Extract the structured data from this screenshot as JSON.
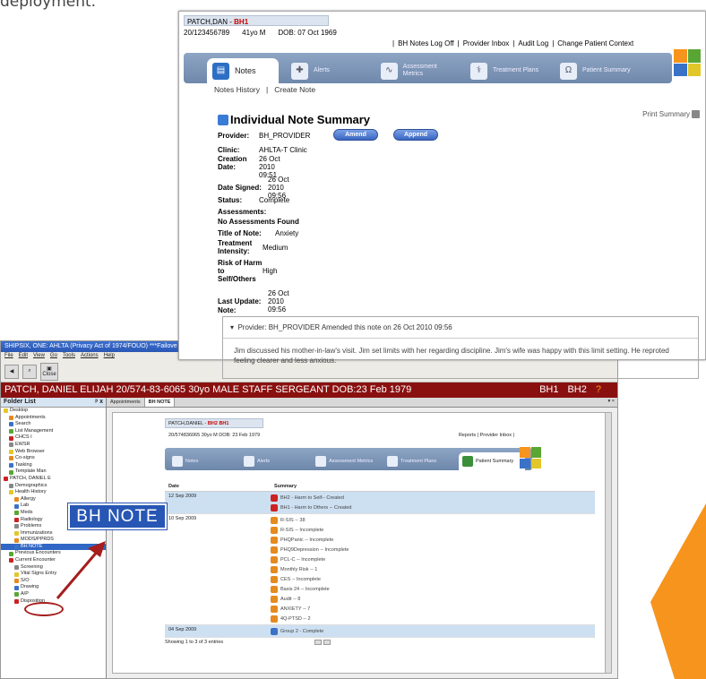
{
  "caption": "deployment.",
  "front": {
    "patient": "PATCH,DAN",
    "patient_bh": "BH1",
    "id": "20/123456789",
    "age": "41yo M",
    "dob": "DOB: 07 Oct 1969",
    "links": [
      "BH Notes Log Off",
      "Provider Inbox",
      "Audit Log",
      "Change Patient Context"
    ],
    "tabs": [
      {
        "label": "Notes",
        "icon": "notes-icon"
      },
      {
        "label": "Alerts",
        "icon": "alerts-icon"
      },
      {
        "label": "Assessment Metrics",
        "icon": "metrics-icon"
      },
      {
        "label": "Treatment Plans",
        "icon": "caduceus-icon"
      },
      {
        "label": "Patient Summary",
        "icon": "omega-icon"
      }
    ],
    "sub_nav": [
      "Notes History",
      "Create Note"
    ],
    "title": "Individual Note Summary",
    "print": "Print Summary",
    "provider_label": "Provider:",
    "provider": "BH_PROVIDER",
    "amend": "Amend",
    "append": "Append",
    "clinic_label": "Clinic:",
    "clinic": "AHLTA-T Clinic",
    "creation_label": "Creation Date:",
    "creation": "26 Oct 2010 09:51",
    "signed_label": "Date Signed:",
    "signed": "26 Oct 2010 09:56",
    "status_label": "Status:",
    "status": "Complete",
    "assess_label": "Assessments:",
    "no_assess": "No Assessments Found",
    "title_note_label": "Title of Note:",
    "title_note": "Anxiety",
    "intensity_label": "Treatment Intensity:",
    "intensity": "Medium",
    "risk_label": "Risk of Harm to Self/Others",
    "risk": "High",
    "update_label": "Last Update:",
    "update": "26 Oct 2010 09:56",
    "note_label": "Note:",
    "note_provider": "Provider: BH_PROVIDER Amended this note on 26 Oct 2010 09:56",
    "note_text": "Jim discussed his mother-in-law's visit. Jim set limits with her regarding discipline. Jim's wife was happy with this limit setting. He reproted feeling clearer and less anxious."
  },
  "back": {
    "title": "SHIPSIX, ONE: AHLTA (Privacy Act of 1974/FOUO) ***Failove",
    "menu": [
      "File",
      "Edit",
      "View",
      "Go",
      "Tools",
      "Actions",
      "Help"
    ],
    "close": "Close",
    "patient_bar": "PATCH, DANIEL ELIJAH 20/574-83-6065 30yo MALE STAFF SERGEANT DOB:23 Feb 1979",
    "bh1": "BH1",
    "bh2": "BH2",
    "folder_list": "Folder List",
    "folders": [
      "Desktop",
      "Appointments",
      "Search",
      "List Management",
      "CHCS I",
      "EWSR",
      "Web Browser",
      "Co-signs",
      "Tasking",
      "Template Man",
      "PATCH, DANIEL E",
      "Demographics",
      "Health History",
      "Allergy",
      "Lab",
      "Meds",
      "Radiology",
      "Problems",
      "Immunizations",
      "MODS/PPRDS",
      "BH NOTE",
      "Previous Encounters",
      "Current Encounter",
      "Screening",
      "Vital Signs Entry",
      "S/O",
      "Drawing",
      "A/P",
      "Disposition"
    ],
    "tab_appointments": "Appointments",
    "tab_bhnote": "BH NOTE",
    "inner_patient": "PATCH,DANIEL -",
    "inner_bh": "BH2 BH1",
    "inner_info": "20/574836065   30yo M   DOB: 23 Feb 1979",
    "inner_links": "Reports | Provider Inbox |",
    "inner_tabs": [
      "Notes",
      "Alerts",
      "Assessment Metrics",
      "Treatment Plans",
      "Patient Summary"
    ],
    "col_date": "Date",
    "col_summary": "Summary",
    "groups": [
      {
        "date": "12 Sep 2009",
        "items": [
          {
            "t": "BH2 - Harm to Self-- Created",
            "c": "r"
          },
          {
            "t": "BH1 - Harm to Others -- Created",
            "c": "r"
          }
        ],
        "hl": true
      },
      {
        "date": "10 Sep 2009",
        "items": [
          {
            "t": "R-SIS -- 38",
            "c": "o"
          },
          {
            "t": "R-SIS -- Incomplete",
            "c": "o"
          },
          {
            "t": "PHQPanic -- Incomplete",
            "c": "o"
          },
          {
            "t": "PHQ9Depression -- Incomplete",
            "c": "o"
          },
          {
            "t": "PCL-C -- Incomplete",
            "c": "o"
          },
          {
            "t": "Monthly Risk -- 1",
            "c": "o"
          },
          {
            "t": "CES -- Incomplete",
            "c": "o"
          },
          {
            "t": "Basis 24 -- Incomplete",
            "c": "o"
          },
          {
            "t": "Audit -- 8",
            "c": "o"
          },
          {
            "t": "ANXIETY -- 7",
            "c": "o"
          },
          {
            "t": "4Q-PTSD -- 2",
            "c": "o"
          }
        ],
        "hl": false
      },
      {
        "date": "04 Sep 2009",
        "items": [
          {
            "t": "Group 2 - Complete",
            "c": "b"
          }
        ],
        "hl": true
      }
    ],
    "showing": "Showing 1 to 3 of 3 entries"
  },
  "callout": "BH NOTE"
}
